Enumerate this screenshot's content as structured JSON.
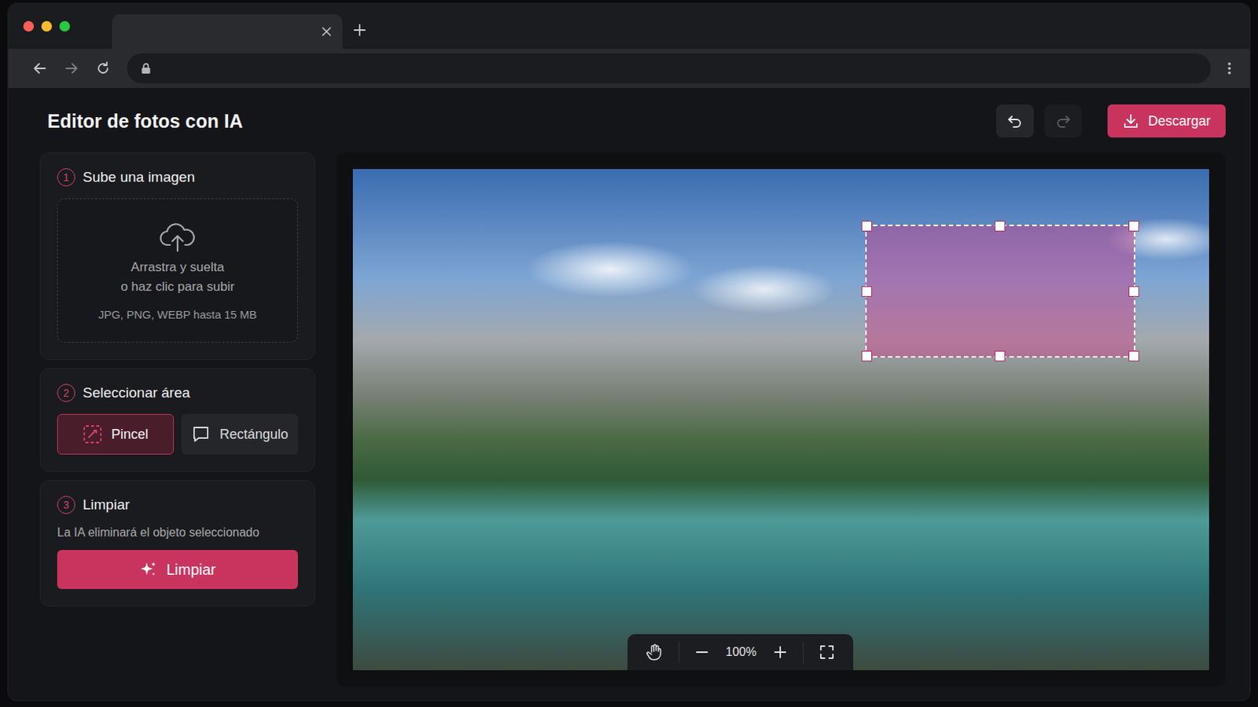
{
  "browser": {
    "tab_title": ""
  },
  "header": {
    "title": "Editor de fotos con IA",
    "undo_enabled": true,
    "redo_enabled": false,
    "download": "Descargar"
  },
  "upload": {
    "number": "1",
    "title": "Sube una imagen",
    "drop_line1": "Arrastra y suelta",
    "drop_line2": "o haz clic para subir",
    "formats": "JPG, PNG, WEBP hasta 15 MB"
  },
  "select": {
    "number": "2",
    "title": "Seleccionar área",
    "tools": [
      {
        "label": "Pincel",
        "selected": true,
        "kind": "brush"
      },
      {
        "label": "Rectángulo",
        "selected": false,
        "kind": "rectangle"
      }
    ]
  },
  "clean": {
    "number": "3",
    "title": "Limpiar",
    "description": "La IA eliminará el objeto seleccionado",
    "button": "Limpiar"
  },
  "canvas": {
    "selection": {
      "visible": true
    },
    "zoom": "100%"
  }
}
